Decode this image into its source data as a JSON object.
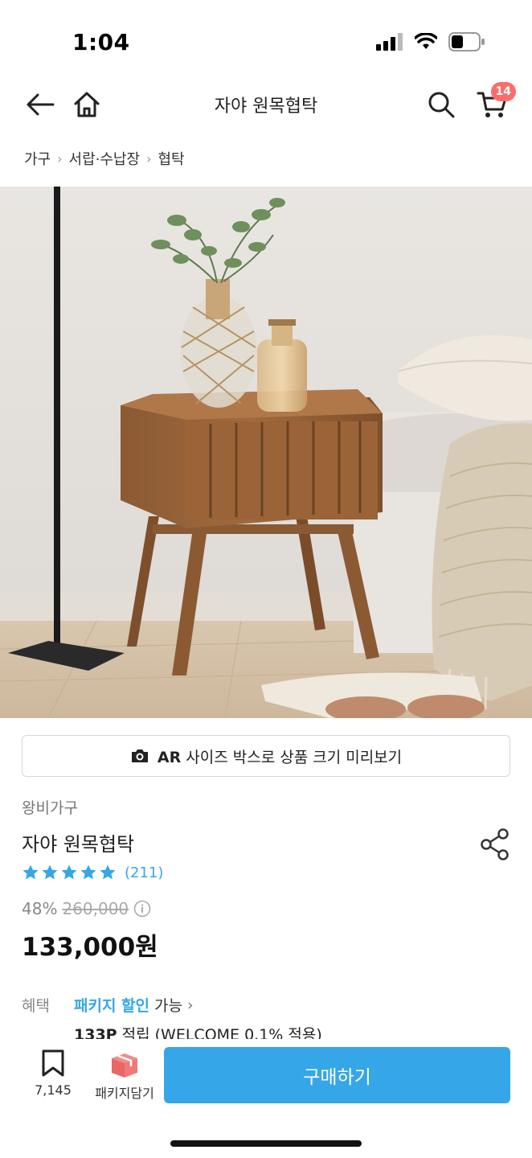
{
  "status_bar": {
    "time": "1:04",
    "battery_level": 0.45
  },
  "nav": {
    "title": "자야 원목협탁",
    "cart_count": "14"
  },
  "breadcrumb": {
    "items": [
      "가구",
      "서랍·수납장",
      "협탁"
    ]
  },
  "ar_button": {
    "strong": "AR",
    "label": "사이즈 박스로 상품 크기 미리보기"
  },
  "product": {
    "brand": "왕비가구",
    "title": "자야 원목협탁",
    "rating_stars": 5,
    "review_count": "(211)",
    "discount": "48%",
    "original_price": "260,000",
    "final_price": "133,000원"
  },
  "benefit": {
    "label": "혜택",
    "link": "패키지 할인",
    "suffix": "가능",
    "points_strong": "133P",
    "points_text": "적립 (WELCOME 0.1% 적용)"
  },
  "bottom_bar": {
    "bookmark_count": "7,145",
    "package_label": "패키지담기",
    "buy_label": "구매하기"
  },
  "colors": {
    "accent": "#35a7e8",
    "badge": "#ff6b6b"
  }
}
